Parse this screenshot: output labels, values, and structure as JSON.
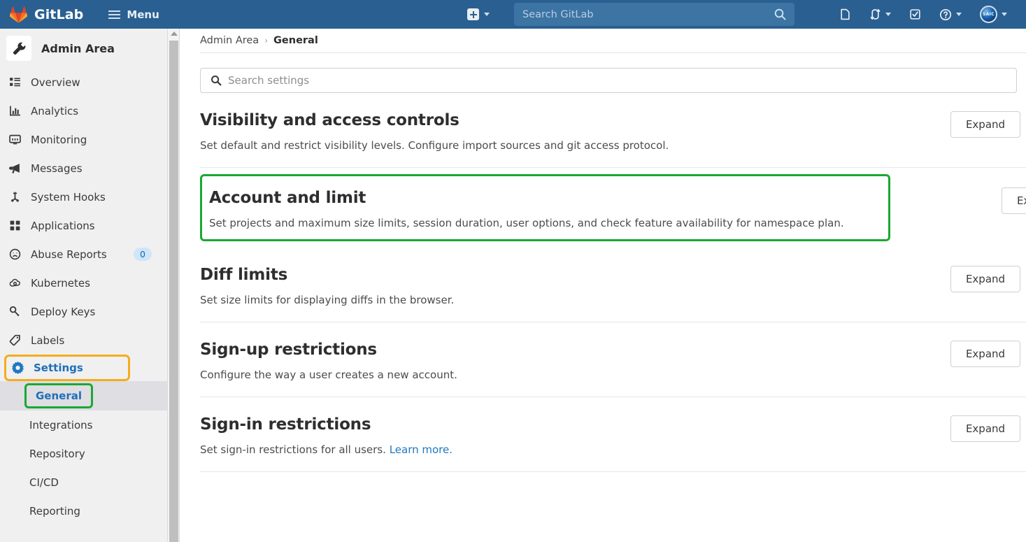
{
  "navbar": {
    "brand": "GitLab",
    "menu_label": "Menu",
    "brand_icon": "gitlab-logo-icon",
    "hamburger_icon": "hamburger-icon",
    "create_new_icon": "plus-square-icon",
    "create_new_caret_icon": "chevron-down-icon",
    "search_placeholder": "Search GitLab",
    "search_icon": "search-icon",
    "right_items": [
      {
        "icon": "issues-icon",
        "label": "",
        "has_caret": false
      },
      {
        "icon": "merge-requests-icon",
        "label": "",
        "has_caret": true
      },
      {
        "icon": "todos-icon",
        "label": "",
        "has_caret": false
      },
      {
        "icon": "help-icon",
        "label": "",
        "has_caret": true
      },
      {
        "icon": "user-avatar-icon",
        "label": "",
        "has_caret": true
      }
    ],
    "avatar_text": "SAIC"
  },
  "sidebar": {
    "title": "Admin Area",
    "title_icon": "wrench-icon",
    "items": [
      {
        "label": "Overview",
        "icon": "overview-list-icon"
      },
      {
        "label": "Analytics",
        "icon": "bar-chart-icon"
      },
      {
        "label": "Monitoring",
        "icon": "monitor-icon"
      },
      {
        "label": "Messages",
        "icon": "megaphone-icon"
      },
      {
        "label": "System Hooks",
        "icon": "hook-icon"
      },
      {
        "label": "Applications",
        "icon": "apps-grid-icon"
      },
      {
        "label": "Abuse Reports",
        "icon": "sad-face-icon",
        "badge": "0"
      },
      {
        "label": "Kubernetes",
        "icon": "kubernetes-cloud-icon"
      },
      {
        "label": "Deploy Keys",
        "icon": "key-icon"
      },
      {
        "label": "Labels",
        "icon": "label-tag-icon"
      }
    ],
    "settings": {
      "label": "Settings",
      "icon": "gear-icon",
      "highlight_color": "#f5ac1d"
    },
    "sub_items": [
      {
        "label": "General",
        "active": true,
        "highlight_color": "#1aa832"
      },
      {
        "label": "Integrations",
        "active": false
      },
      {
        "label": "Repository",
        "active": false
      },
      {
        "label": "CI/CD",
        "active": false
      },
      {
        "label": "Reporting",
        "active": false
      }
    ],
    "scrollbar_arrow_icon": "scroll-up-arrow-icon"
  },
  "breadcrumb": {
    "root": "Admin Area",
    "separator": "›",
    "current": "General"
  },
  "search_settings": {
    "placeholder": "Search settings",
    "icon": "search-icon",
    "value": ""
  },
  "sections": [
    {
      "title": "Visibility and access controls",
      "description": "Set default and restrict visibility levels. Configure import sources and git access protocol.",
      "expand_label": "Expand",
      "highlighted": false
    },
    {
      "title": "Account and limit",
      "description": "Set projects and maximum size limits, session duration, user options, and check feature availability for namespace plan.",
      "expand_label": "Expand",
      "highlighted": true,
      "highlight_color": "#1aa832"
    },
    {
      "title": "Diff limits",
      "description": "Set size limits for displaying diffs in the browser.",
      "expand_label": "Expand",
      "highlighted": false
    },
    {
      "title": "Sign-up restrictions",
      "description": "Configure the way a user creates a new account.",
      "expand_label": "Expand",
      "highlighted": false
    },
    {
      "title": "Sign-in restrictions",
      "description": "Set sign-in restrictions for all users.",
      "link_text": "Learn more.",
      "expand_label": "Expand",
      "highlighted": false
    }
  ]
}
